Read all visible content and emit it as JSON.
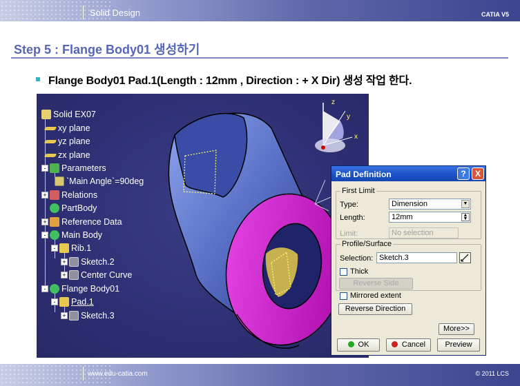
{
  "header": {
    "section": "Solid Design",
    "brand": "CATIA V5"
  },
  "step_title": "Step 5 : Flange Body01 생성하기",
  "bullet": "Flange Body01 Pad.1(Length : 12mm , Direction : + X Dir) 생성 작업 한다.",
  "tree": {
    "items": [
      {
        "label": "Solid EX07"
      },
      {
        "label": "xy plane"
      },
      {
        "label": "yz plane"
      },
      {
        "label": "zx plane"
      },
      {
        "label": "Parameters"
      },
      {
        "label": "`Main Angle`=90deg"
      },
      {
        "label": "Relations"
      },
      {
        "label": "PartBody"
      },
      {
        "label": "Reference Data"
      },
      {
        "label": "Main Body"
      },
      {
        "label": "Rib.1"
      },
      {
        "label": "Sketch.2"
      },
      {
        "label": "Center Curve"
      },
      {
        "label": "Flange Body01"
      },
      {
        "label": "Pad.1"
      },
      {
        "label": "Sketch.3"
      }
    ]
  },
  "compass": {
    "x": "x",
    "y": "y",
    "z": "z"
  },
  "dialog": {
    "title": "Pad Definition",
    "help_glyph": "?",
    "close_glyph": "X",
    "first_limit": "First Limit",
    "type_label": "Type:",
    "type_value": "Dimension",
    "length_label": "Length:",
    "length_value": "12mm",
    "limit_label": "Limit:",
    "limit_value": "No selection",
    "profile_surface": "Profile/Surface",
    "selection_label": "Selection:",
    "selection_value": "Sketch.3",
    "thick_label": "Thick",
    "reverse_side": "Reverse Side",
    "mirrored_extent": "Mirrored extent",
    "reverse_direction": "Reverse Direction",
    "more": "More>>",
    "ok": "OK",
    "cancel": "Cancel",
    "preview": "Preview"
  },
  "footer": {
    "url": "www.edu-catia.com",
    "copyright": "© 2011 LCS"
  },
  "colors": {
    "title_blue": "#5566b8",
    "viewport_bg": "#2e2f73",
    "flange_magenta": "#cc22cc",
    "pipe_blue": "#5b72c8",
    "dialog_title": "#1d54c8"
  }
}
